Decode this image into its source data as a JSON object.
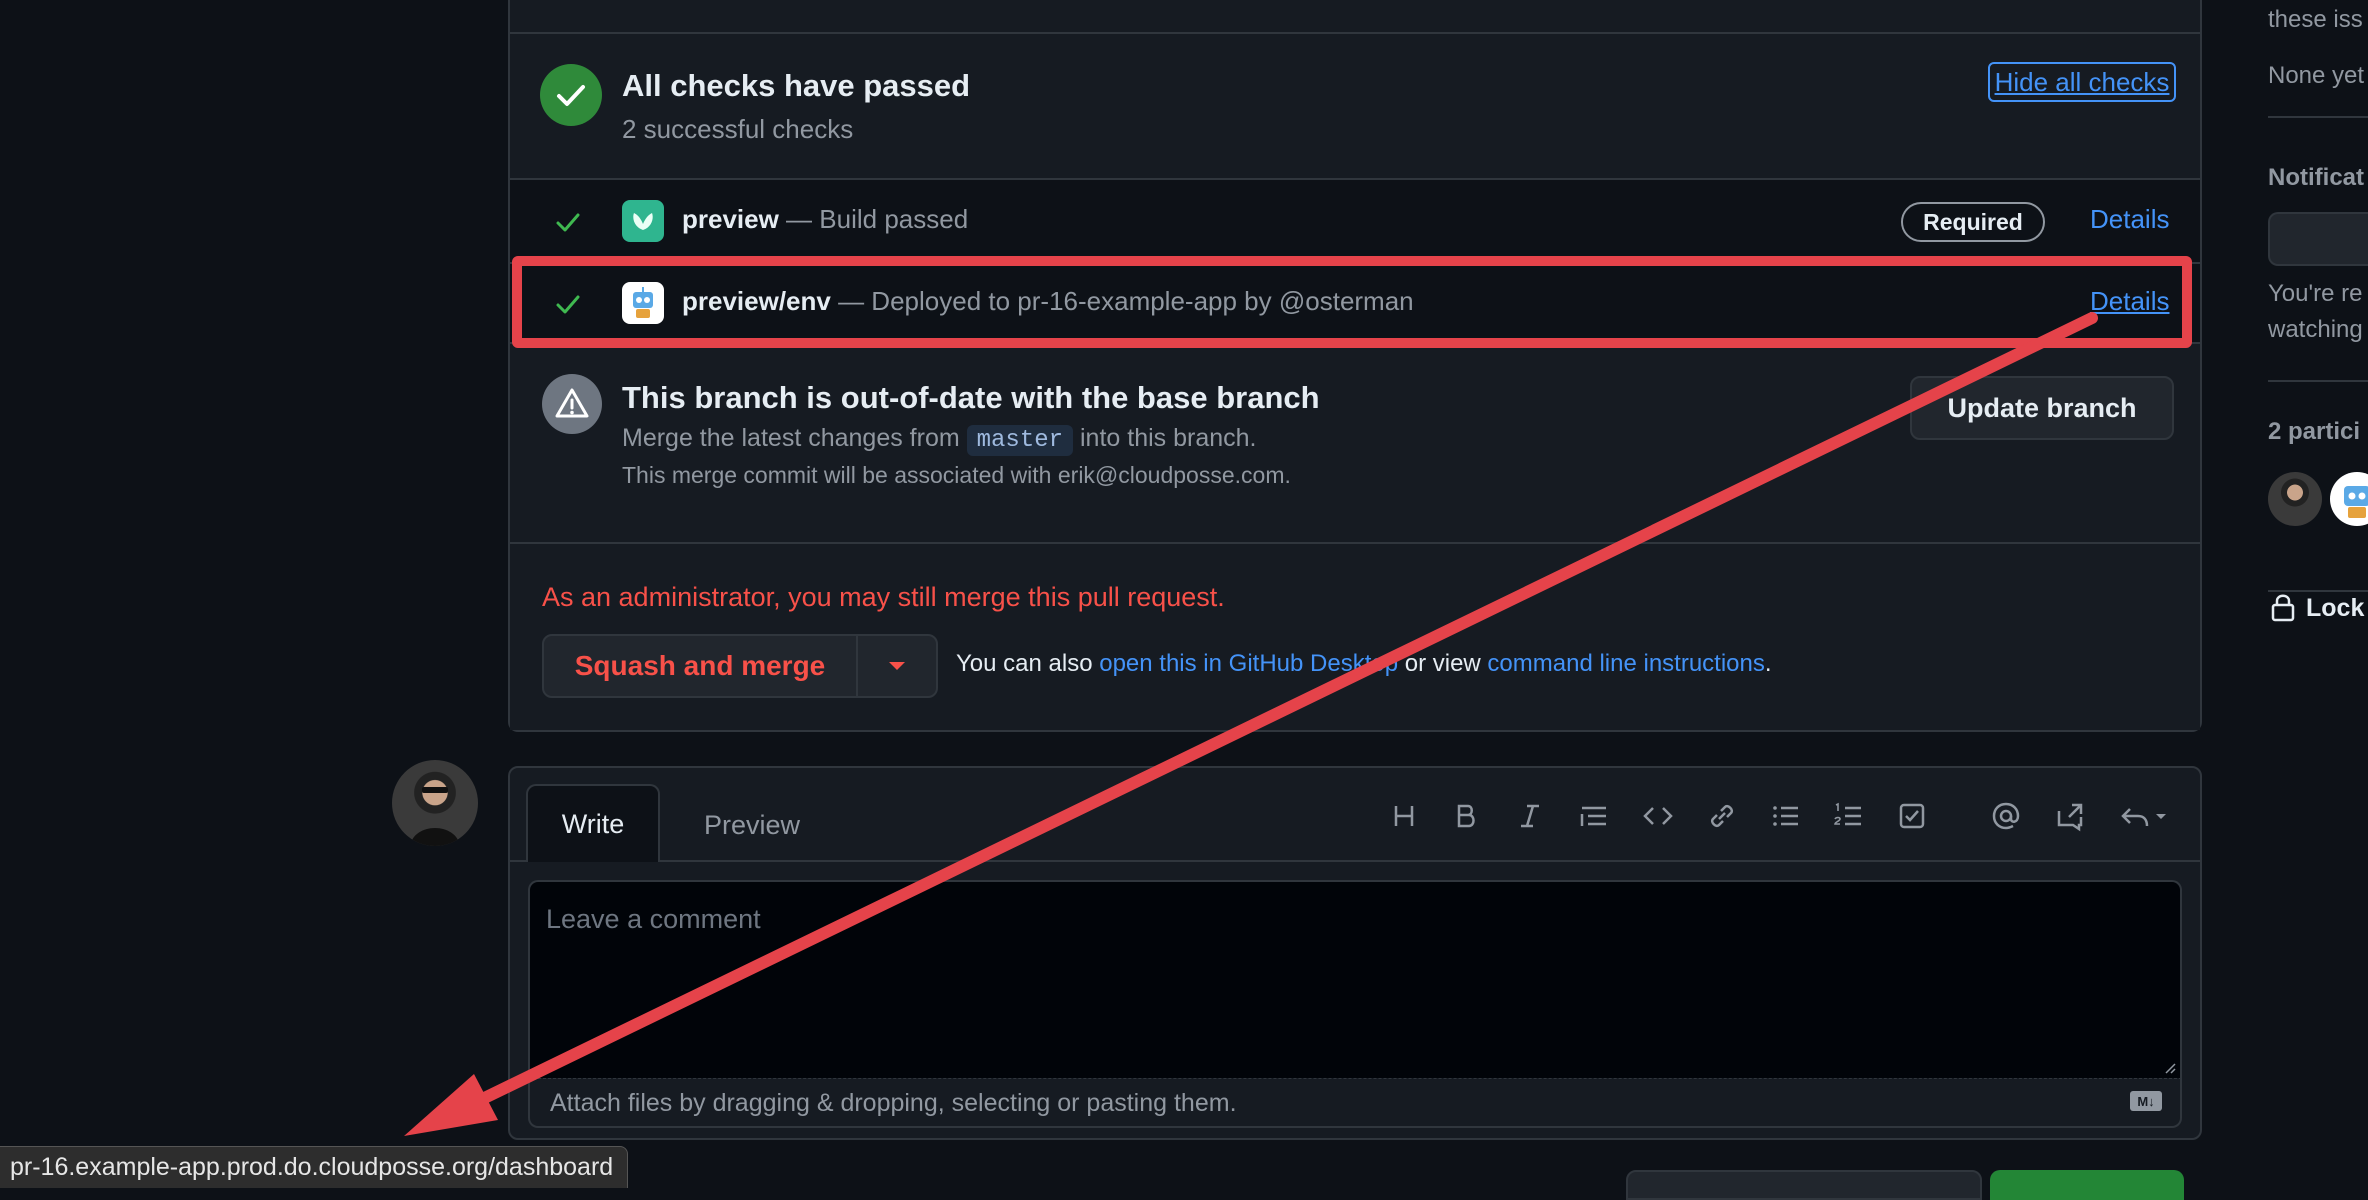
{
  "checks": {
    "title": "All checks have passed",
    "subtitle": "2 successful checks",
    "hide_label": "Hide all checks",
    "rows": [
      {
        "name": "preview",
        "desc": " — Build passed",
        "badge": "Required",
        "details": "Details"
      },
      {
        "name": "preview/env",
        "desc": " — Deployed to pr-16-example-app by @osterman",
        "details": "Details"
      }
    ]
  },
  "branch": {
    "title": "This branch is out-of-date with the base branch",
    "line1_pre": "Merge the latest changes from ",
    "base_branch": "master",
    "line1_post": " into this branch.",
    "line2": "This merge commit will be associated with erik@cloudposse.com.",
    "update_label": "Update branch"
  },
  "merge": {
    "admin_notice": "As an administrator, you may still merge this pull request.",
    "button_label": "Squash and merge",
    "also_pre": "You can also ",
    "desktop_link": "open this in GitHub Desktop",
    "also_mid": " or view ",
    "cli_link": "command line instructions",
    "also_post": "."
  },
  "comment": {
    "tab_write": "Write",
    "tab_preview": "Preview",
    "placeholder": "Leave a comment",
    "attach_text": "Attach files by dragging & dropping, selecting or pasting them.",
    "md_badge": "M↓"
  },
  "sidebar": {
    "issues_text": "these iss",
    "none_text": "None yet",
    "notifications_heading": "Notificat",
    "watch_line1": "You're re",
    "watch_line2": "watching",
    "participants": "2 partici",
    "lock": "Lock"
  },
  "status_url": "pr-16.example-app.prod.do.cloudposse.org/dashboard",
  "colors": {
    "success": "#3fb950",
    "danger": "#f85149",
    "link": "#4493f8",
    "annotation": "#e5434a"
  }
}
